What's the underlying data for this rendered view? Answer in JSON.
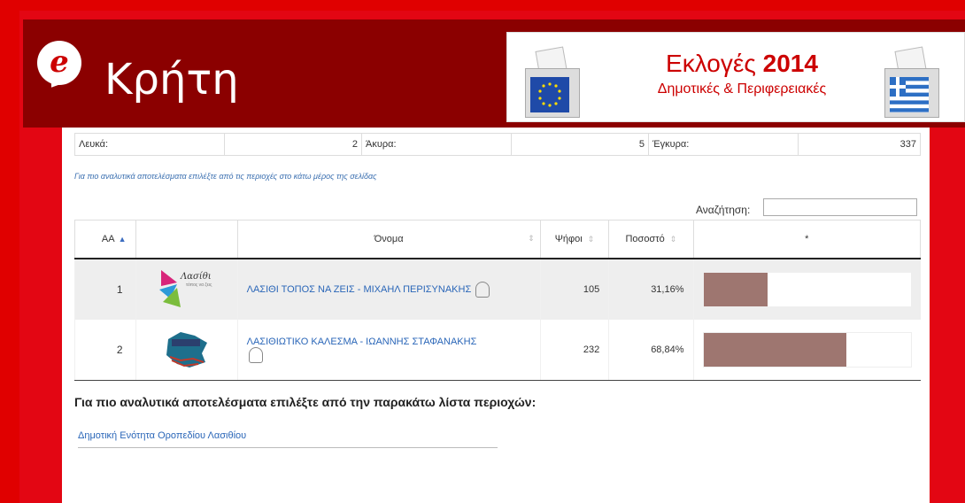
{
  "header": {
    "site_title": "Κρήτη",
    "logo_letter": "e",
    "banner_title_a": "Εκλογές ",
    "banner_title_b": "2014",
    "banner_subtitle": "Δημοτικές & Περιφερειακές"
  },
  "summary": {
    "blank_label": "Λευκά:",
    "blank_value": "2",
    "invalid_label": "Άκυρα:",
    "invalid_value": "5",
    "valid_label": "Έγκυρα:",
    "valid_value": "337"
  },
  "hint_small": "Για πιο αναλυτικά αποτελέσματα επιλέξτε από τις περιοχές στο κάτω μέρος της σελίδας",
  "search": {
    "label": "Αναζήτηση:",
    "value": ""
  },
  "table": {
    "columns": [
      "ΑΑ",
      "",
      "Όνομα",
      "Ψήφοι",
      "Ποσοστό",
      "*"
    ],
    "rows": [
      {
        "aa": "1",
        "name": "ΛΑΣΙΘΙ ΤΟΠΟΣ ΝΑ ΖΕΙΣ - ΜΙΧΑΗΛ ΠΕΡΙΣΥΝΑΚΗΣ",
        "votes": "105",
        "percent": "31,16%",
        "share": 0.3116,
        "logo": "lasithi-topos-logo"
      },
      {
        "aa": "2",
        "name": "ΛΑΣΙΘΙΩΤΙΚΟ ΚΑΛΕΣΜΑ - ΙΩΑΝΝΗΣ ΣΤΑΦΑΝΑΚΗΣ",
        "votes": "232",
        "percent": "68,84%",
        "share": 0.6884,
        "logo": "lasithiotiko-kalesma-logo"
      }
    ]
  },
  "sections": {
    "title": "Για πιο αναλυτικά αποτελέσματα επιλέξτε από την παρακάτω λίστα περιοχών:",
    "area_link": "Δημοτική Ενότητα Οροπεδίου Λασιθίου"
  },
  "colors": {
    "header_bg": "#8b0000",
    "border_red": "#e30613",
    "bar_fill": "#9e7670",
    "link_blue": "#2a66b8"
  }
}
